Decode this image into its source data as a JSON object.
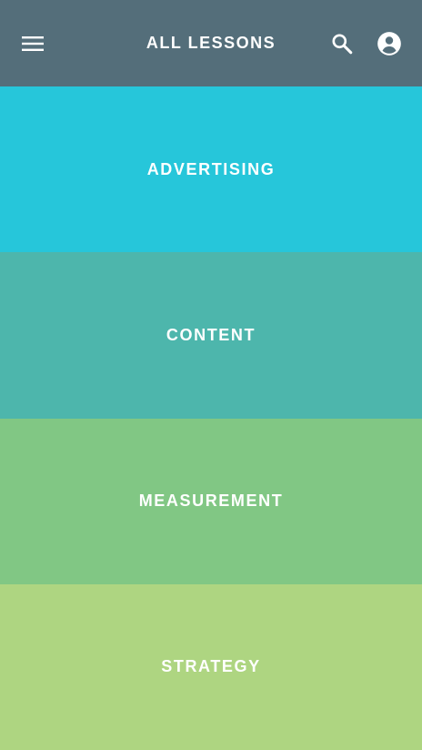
{
  "header": {
    "title": "ALL LESSONS",
    "background": "#546e7a",
    "icons": {
      "menu": "menu-icon",
      "search": "search-icon",
      "account": "account-circle-icon"
    }
  },
  "categories": [
    {
      "label": "ADVERTISING",
      "color": "#26c6da"
    },
    {
      "label": "CONTENT",
      "color": "#4db6ac"
    },
    {
      "label": "MEASUREMENT",
      "color": "#81c784"
    },
    {
      "label": "STRATEGY",
      "color": "#aed581"
    }
  ]
}
